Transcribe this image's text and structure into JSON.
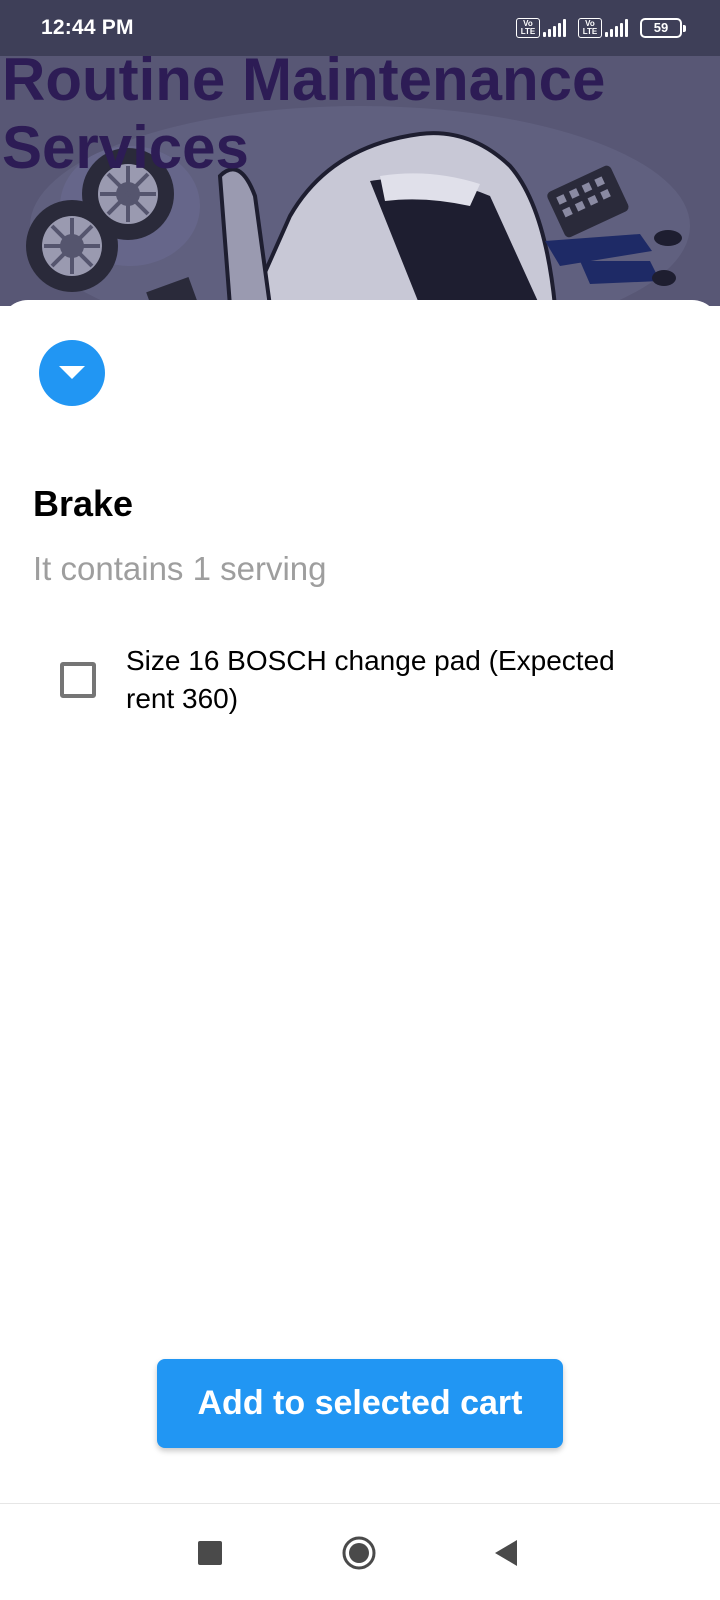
{
  "status_bar": {
    "time": "12:44 PM",
    "sim1_label": "Vo LTE",
    "sim2_label": "Vo LTE",
    "battery": "59"
  },
  "header": {
    "title": "Routine Maintenance Services"
  },
  "section": {
    "title": "Brake",
    "subtitle": "It contains 1 serving"
  },
  "options": [
    {
      "label": "Size 16 BOSCH change pad (Expected rent 360)",
      "checked": false
    }
  ],
  "actions": {
    "add_to_cart_label": "Add to selected cart"
  },
  "nav": {
    "recents_icon": "square-icon",
    "home_icon": "circle-icon",
    "back_icon": "triangle-back-icon"
  },
  "colors": {
    "accent": "#2196f3",
    "status_bar": "#3e3f58",
    "banner_overlay": "#585775",
    "banner_title": "#2d1c55",
    "subtitle_gray": "#9e9e9e"
  }
}
